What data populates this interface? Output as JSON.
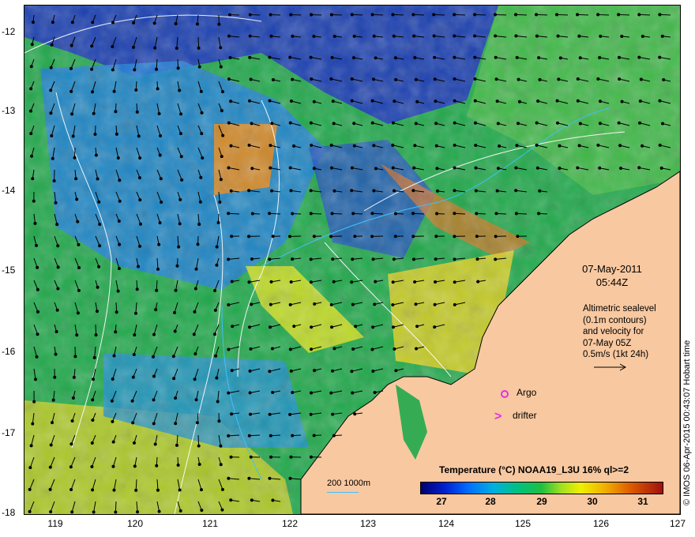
{
  "map": {
    "y_ticks": [
      "-12",
      "-13",
      "-14",
      "-15",
      "-16",
      "-17",
      "-18"
    ],
    "x_ticks": [
      "119",
      "120",
      "121",
      "122",
      "123",
      "124",
      "125",
      "126",
      "127"
    ],
    "date": "07-May-2011",
    "time": "05:44Z",
    "altimetry_lines": [
      "Altimetric sealevel",
      "(0.1m contours)",
      "and velocity for",
      "07-May 05Z",
      "0.5m/s (1kt 24h)"
    ],
    "argo_label": "Argo",
    "drifter_label": "drifter",
    "scale_label": "200  1000m",
    "colorbar_title": "Temperature (°C) NOAA19_L3U 16% ql>=2",
    "colorbar_ticks": [
      "27",
      "28",
      "29",
      "30",
      "31"
    ],
    "credit": "© IMOS 06-Apr-2015 00:43:07 Hobart time"
  },
  "colors": {
    "land": "#f8c8a0",
    "argo": "#e030e0",
    "contour": "#ffffff",
    "isobath": "#40c0ff"
  }
}
